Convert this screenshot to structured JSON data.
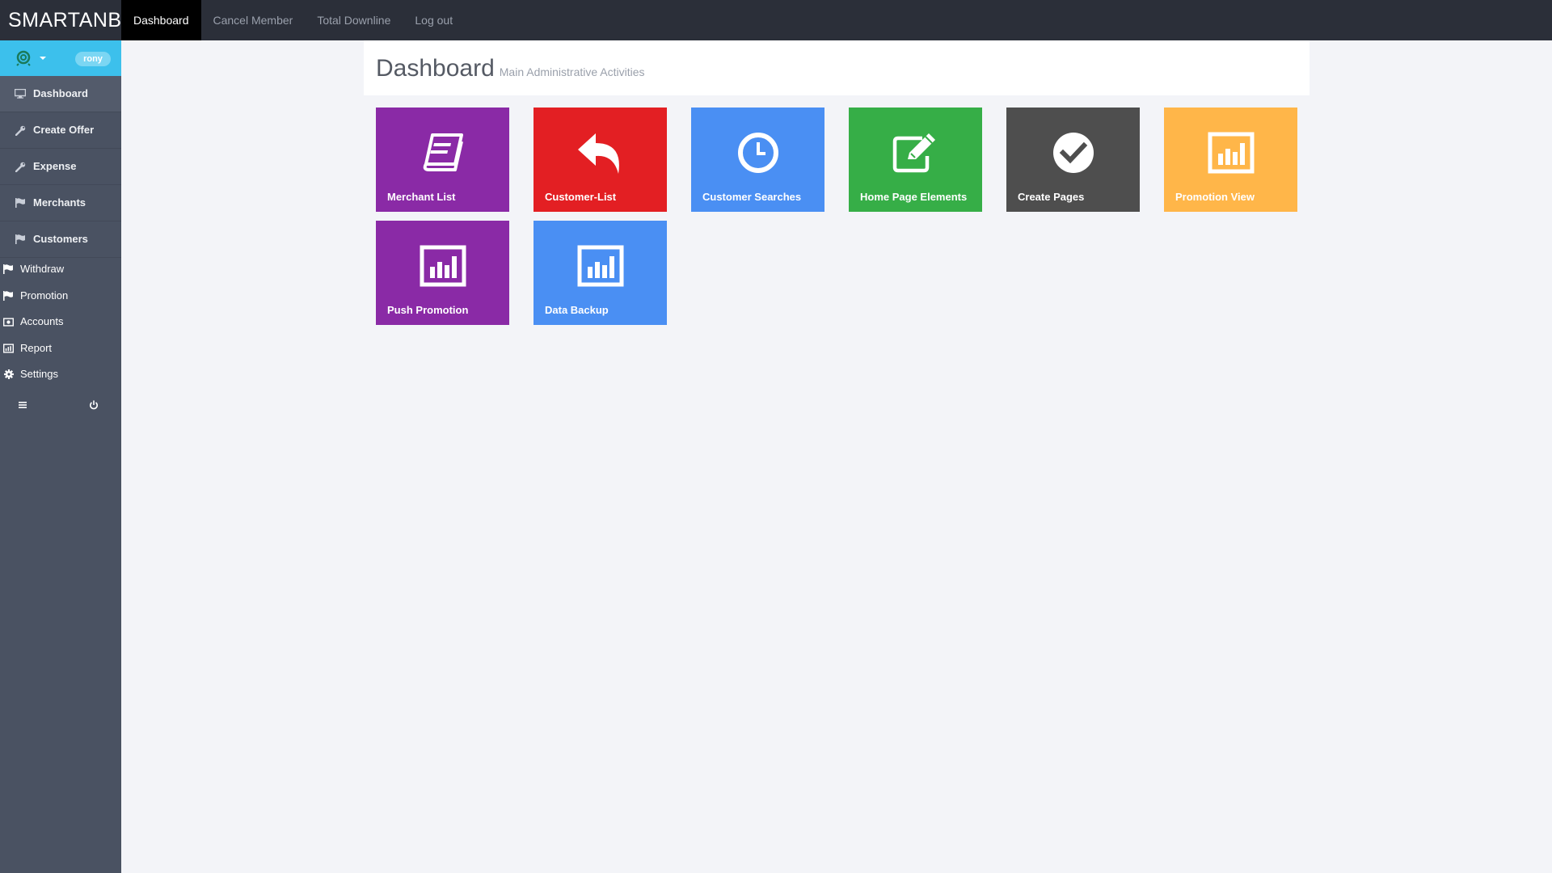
{
  "brand": "SMARTANB",
  "topnav": [
    "Dashboard",
    "Cancel Member",
    "Total Downline",
    "Log out"
  ],
  "user": {
    "name": "rony"
  },
  "sidebar": {
    "main": [
      {
        "label": "Dashboard",
        "icon": "monitor-icon"
      },
      {
        "label": "Create Offer",
        "icon": "wrench-icon"
      },
      {
        "label": "Expense",
        "icon": "wrench-icon"
      },
      {
        "label": "Merchants",
        "icon": "flag-icon"
      },
      {
        "label": "Customers",
        "icon": "flag-icon"
      }
    ],
    "secondary": [
      {
        "label": "Withdraw",
        "icon": "flag-icon"
      },
      {
        "label": "Promotion",
        "icon": "flag-icon"
      },
      {
        "label": "Accounts",
        "icon": "money-icon"
      },
      {
        "label": "Report",
        "icon": "bar-chart-icon"
      },
      {
        "label": "Settings",
        "icon": "gear-icon"
      }
    ]
  },
  "header": {
    "title": "Dashboard",
    "subtitle": "Main Administrative Activities"
  },
  "tiles": [
    {
      "label": "Merchant List",
      "icon": "book-icon",
      "color": "#8a2aa6"
    },
    {
      "label": "Customer-List",
      "icon": "reply-icon",
      "color": "#e31f23"
    },
    {
      "label": "Customer Searches",
      "icon": "clock-icon",
      "color": "#4a8ff3"
    },
    {
      "label": "Home Page Elements",
      "icon": "edit-icon",
      "color": "#36ae47"
    },
    {
      "label": "Create Pages",
      "icon": "check-circle-icon",
      "color": "#4e4e4e"
    },
    {
      "label": "Promotion View",
      "icon": "bar-chart-icon",
      "color": "#ffb649"
    },
    {
      "label": "Push Promotion",
      "icon": "bar-chart-icon",
      "color": "#8a2aa6"
    },
    {
      "label": "Data Backup",
      "icon": "bar-chart-icon",
      "color": "#4a8ff3"
    }
  ]
}
